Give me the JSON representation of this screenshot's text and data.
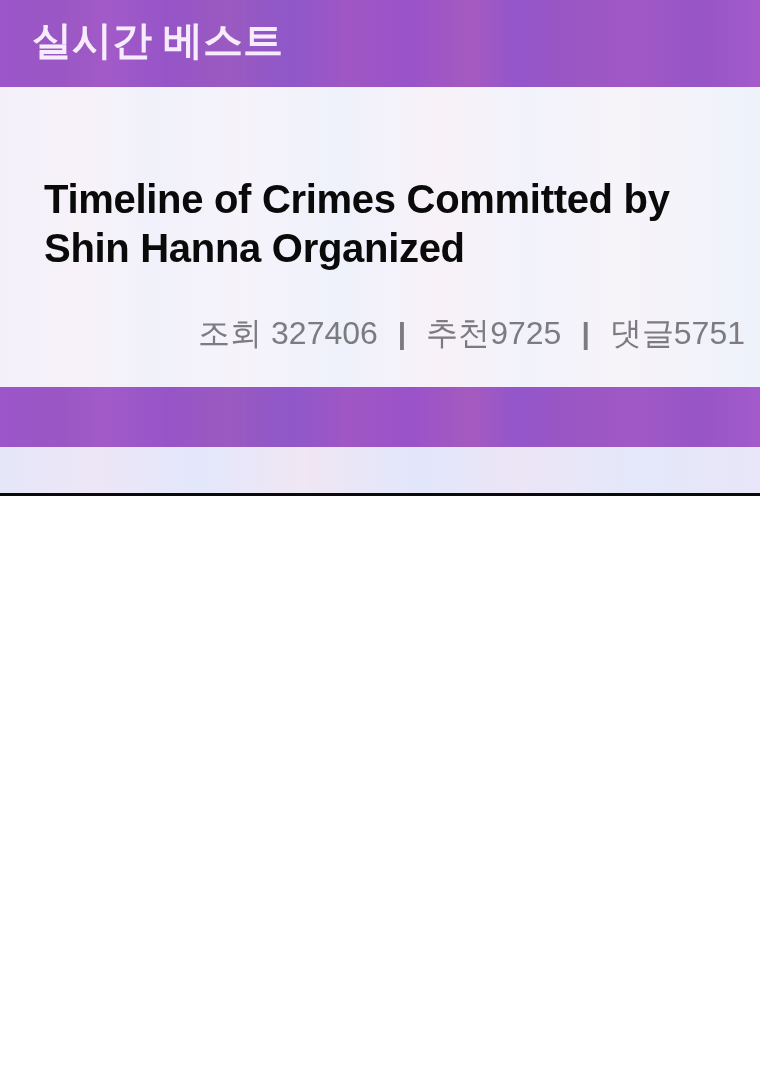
{
  "header": {
    "title": "실시간 베스트"
  },
  "post": {
    "title": "Timeline of Crimes Committed by Shin Hanna Organized",
    "stats": [
      {
        "kind": "stat",
        "text": "조회 327406"
      },
      {
        "kind": "divider",
        "text": "|"
      },
      {
        "kind": "stat",
        "text": "추천9725"
      },
      {
        "kind": "divider",
        "text": "|"
      },
      {
        "kind": "stat",
        "text": "댓글5751"
      }
    ]
  }
}
